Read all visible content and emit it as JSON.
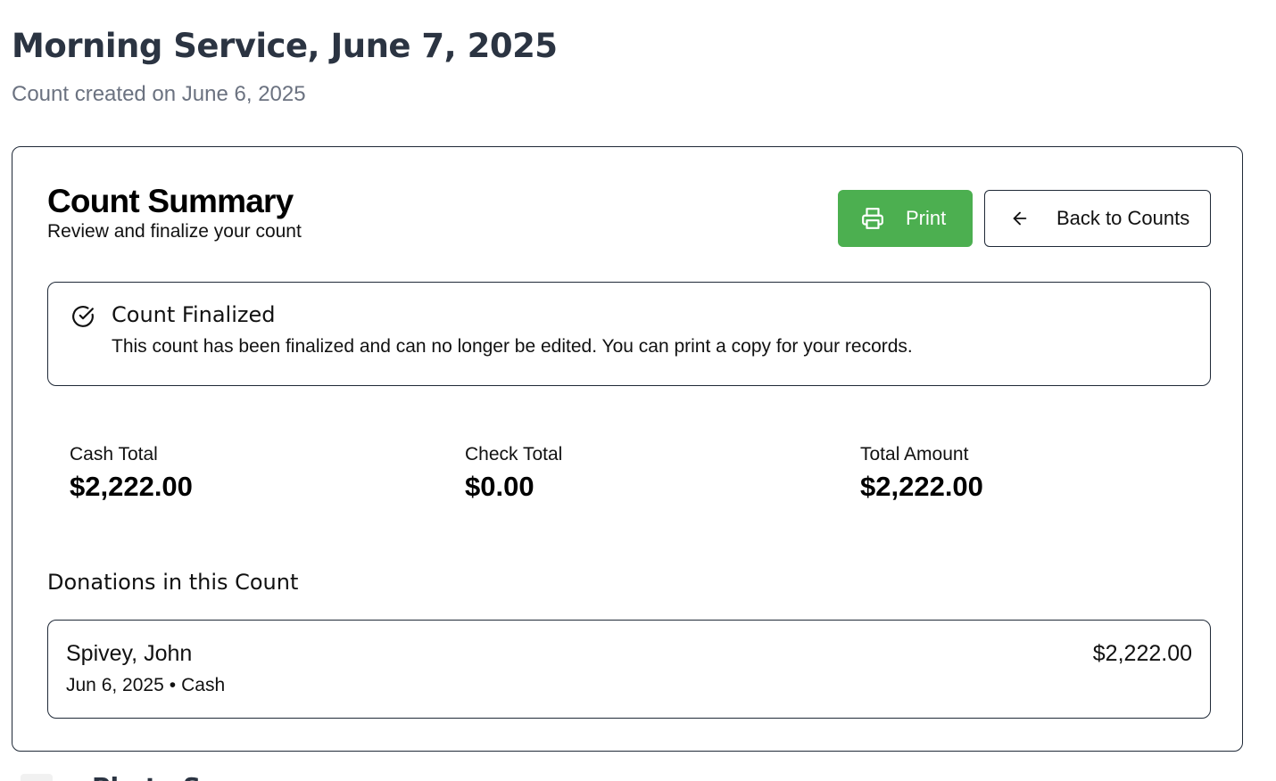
{
  "page": {
    "title": "Morning Service, June 7, 2025",
    "subtitle": "Count created on June 6, 2025"
  },
  "summary": {
    "title": "Count Summary",
    "subtitle": "Review and finalize your count",
    "print_label": "Print",
    "back_label": "Back to Counts"
  },
  "status": {
    "title": "Count Finalized",
    "message": "This count has been finalized and can no longer be edited. You can print a copy for your records."
  },
  "totals": [
    {
      "label": "Cash Total",
      "value": "$2,222.00"
    },
    {
      "label": "Check Total",
      "value": "$0.00"
    },
    {
      "label": "Total Amount",
      "value": "$2,222.00"
    }
  ],
  "donations": {
    "title": "Donations in this Count",
    "items": [
      {
        "name": "Spivey, John",
        "date": "Jun 6, 2025",
        "method": "Cash",
        "amount": "$2,222.00"
      }
    ]
  },
  "next_section": {
    "title": "Photo Scans"
  },
  "colors": {
    "accent": "#4caf50",
    "heading": "#2b3442",
    "muted": "#6b7280",
    "border": "#1f2937"
  },
  "icons": {
    "print": "printer-icon",
    "back": "arrow-left-icon",
    "status": "check-circle-icon"
  }
}
